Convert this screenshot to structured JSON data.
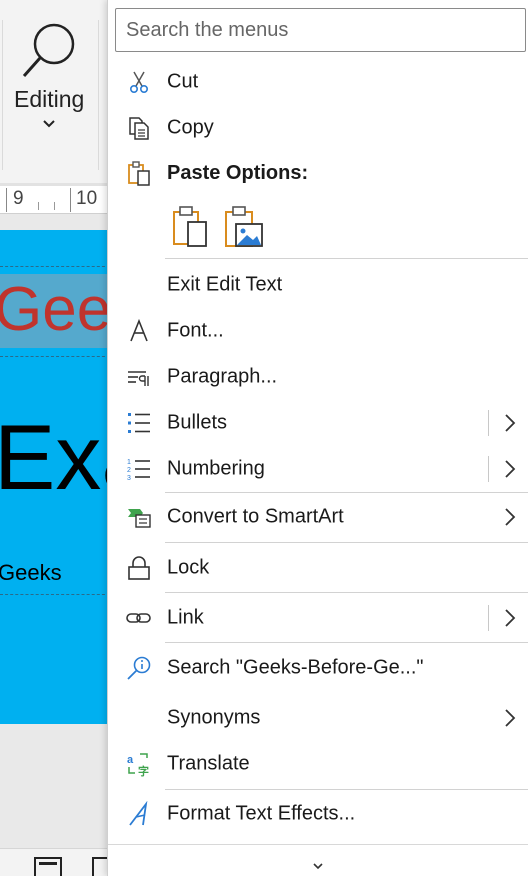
{
  "ribbon": {
    "editing_label": "Editing"
  },
  "ruler": {
    "tick_9": "9",
    "tick_10": "10"
  },
  "slide": {
    "text_geek": "Geek",
    "text_am": "Exam",
    "text_eks": "Geeks"
  },
  "context_menu": {
    "search_placeholder": "Search the menus",
    "items": {
      "cut": {
        "label": "Cut",
        "icon": "scissors-icon"
      },
      "copy": {
        "label": "Copy",
        "icon": "copy-icon"
      },
      "paste_options": {
        "label": "Paste Options:",
        "icon": "clipboard-icon"
      },
      "exit_edit_text": {
        "label": "Exit Edit Text"
      },
      "font": {
        "label": "Font...",
        "icon": "font-icon"
      },
      "paragraph": {
        "label": "Paragraph...",
        "icon": "paragraph-icon"
      },
      "bullets": {
        "label": "Bullets",
        "icon": "bullets-icon"
      },
      "numbering": {
        "label": "Numbering",
        "icon": "numbering-icon"
      },
      "convert_smartart": {
        "label": "Convert to SmartArt",
        "icon": "smartart-icon"
      },
      "lock": {
        "label": "Lock",
        "icon": "lock-icon"
      },
      "link": {
        "label": "Link",
        "icon": "link-icon"
      },
      "search": {
        "label": "Search \"Geeks-Before-Ge...\"",
        "icon": "search-icon"
      },
      "synonyms": {
        "label": "Synonyms"
      },
      "translate": {
        "label": "Translate",
        "icon": "translate-icon"
      },
      "format_text_effects": {
        "label": "Format Text Effects...",
        "icon": "text-effects-icon"
      }
    }
  },
  "colors": {
    "slide_background": "#00b0f0",
    "accent_blue": "#2b7cd3",
    "accent_orange": "#d98c1e",
    "geek_text_red": "#c0342d"
  }
}
